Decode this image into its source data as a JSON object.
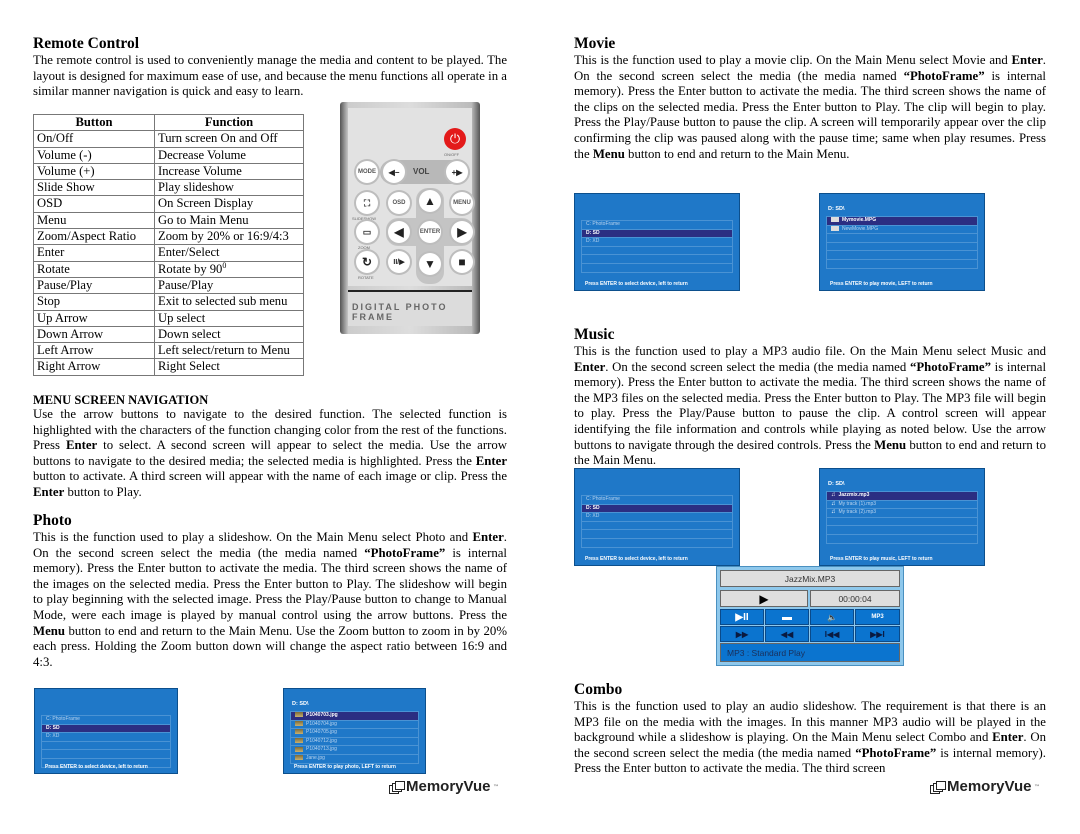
{
  "left": {
    "remote_control": {
      "title": "Remote Control",
      "intro": "The remote control is used to conveniently manage the media and content to be played. The layout is designed for maximum ease of use, and because the menu functions all operate in a similar manner navigation is quick and easy to learn.",
      "table": {
        "headers": [
          "Button",
          "Function"
        ],
        "rows": [
          [
            "On/Off",
            "Turn screen On and Off"
          ],
          [
            "Volume (-)",
            "Decrease Volume"
          ],
          [
            "Volume (+)",
            "Increase Volume"
          ],
          [
            "Slide Show",
            "Play slideshow"
          ],
          [
            "OSD",
            "On Screen Display"
          ],
          [
            "Menu",
            "Go to Main Menu"
          ],
          [
            "Zoom/Aspect Ratio",
            "Zoom by 20% or 16:9/4:3"
          ],
          [
            "Enter",
            "Enter/Select"
          ],
          [
            "Rotate",
            "Rotate by 90"
          ],
          [
            "Pause/Play",
            "Pause/Play"
          ],
          [
            "Stop",
            "Exit to selected sub menu"
          ],
          [
            "Up Arrow",
            "Up select"
          ],
          [
            "Down Arrow",
            "Down select"
          ],
          [
            "Left Arrow",
            "Left select/return to Menu"
          ],
          [
            "Right Arrow",
            "Right Select"
          ]
        ],
        "rotate_superscript": "0"
      },
      "remote_image": {
        "power_label": "ON/OFF",
        "mode": "MODE",
        "vol": "VOL",
        "vol_minus": "◀−",
        "vol_plus": "+▶",
        "slideshow_label": "SLIDESHOW",
        "osd": "OSD",
        "menu": "MENU",
        "enter": "ENTER",
        "zoom_label": "ZOOM",
        "rotate_label": "ROTATE",
        "up": "▲",
        "down": "▼",
        "left": "◀",
        "right": "▶",
        "pause_play": "II/▶",
        "stop": "■",
        "brand_strip": "DIGITAL PHOTO FRAME"
      }
    },
    "menu_nav": {
      "title": "MENU SCREEN NAVIGATION",
      "p1": "Use the arrow buttons to navigate to the desired function. The selected function is highlighted with the characters of the function changing color from the rest of the functions. Press ",
      "b1": "Enter",
      "p2": " to select. A second screen will appear to select the media. Use the arrow buttons to navigate to the desired media; the selected media is highlighted. Press the ",
      "b2": "Enter",
      "p3": " button to activate. A third screen will appear with the name of each image or clip. Press the ",
      "b3": "Enter",
      "p4": " button to Play."
    },
    "photo": {
      "title": "Photo",
      "p1": "This is the function used to play a slideshow. On the Main Menu select Photo and ",
      "b1": "Enter",
      "p2": ". On the second screen select the media (the media named ",
      "b2": "“PhotoFrame”",
      "p3": " is internal memory). Press the Enter button to activate the media.  The third screen shows the name of the images on the selected media. Press the Enter button to Play. The slideshow will begin to play beginning with the selected image. Press the Play/Pause button to change to Manual Mode, were each image is played by manual control using the arrow buttons. Press the ",
      "b3": "Menu",
      "p4": " button to end and return to the Main Menu. Use the Zoom button to zoom in by 20% each press. Holding the Zoom button down will change the aspect ratio between 16:9 and 4:3.",
      "device_screen": {
        "rows": [
          "C:  PhotoFrame",
          "D:  SD",
          "D:  XD",
          "",
          "",
          ""
        ],
        "selected": 1,
        "footer": "Press ENTER to select device, left to return"
      },
      "file_screen": {
        "header": "D: SD\\",
        "rows": [
          "P1040703.jpg",
          "P1040704.jpg",
          "P1040705.jpg",
          "P1040712.jpg",
          "P1040713.jpg",
          "Jane.jpg"
        ],
        "selected": 0,
        "footer": "Press ENTER to play photo, LEFT to return"
      }
    },
    "logo": "MemoryVue",
    "logo_mark": "™"
  },
  "right": {
    "movie": {
      "title": "Movie",
      "p1": "This is the function used to play a movie clip. On the Main Menu select Movie and ",
      "b1": "Enter",
      "p2": ". On the second screen select the media (the media named ",
      "b2": "“PhotoFrame”",
      "p3": " is internal memory). Press the Enter button to activate the media.  The third screen shows the name of the clips on the selected media. Press the Enter button to Play. The clip will begin to play. Press the Play/Pause button to pause the clip. A screen will temporarily appear over the clip confirming the clip was paused along with the pause time; same when play resumes. Press the ",
      "b3": "Menu",
      "p4": " button to end and return to the Main Menu.",
      "device_screen": {
        "rows": [
          "C:  PhotoFrame",
          "D:  SD",
          "D:  XD",
          "",
          "",
          ""
        ],
        "selected": 1,
        "footer": "Press ENTER to select device, left to return"
      },
      "file_screen": {
        "header": "D: SD\\",
        "rows": [
          "Mymovie.MPG",
          "NewMovie.MPG",
          "",
          "",
          "",
          ""
        ],
        "selected": 0,
        "footer": "Press ENTER to play movie, LEFT to return"
      }
    },
    "music": {
      "title": "Music",
      "p1": "This is the function used to play a MP3 audio file. On the Main Menu select Music and ",
      "b1": "Enter",
      "p2": ". On the second screen select the media (the media named ",
      "b2": "“PhotoFrame”",
      "p3": " is internal memory). Press the Enter button to activate the media.  The third screen shows the name of the MP3 files on the selected media. Press the Enter button to Play. The MP3 file will begin to play. Press the Play/Pause button to pause the clip. A control screen will appear identifying the file information and controls while playing as noted below. Use the arrow buttons to navigate through the desired controls. Press the ",
      "b3": "Menu",
      "p4": " button to end and return to the Main Menu.",
      "device_screen": {
        "rows": [
          "C:  PhotoFrame",
          "D:  SD",
          "D:  XD",
          "",
          "",
          ""
        ],
        "selected": 1,
        "footer": "Press ENTER to select device, left to return"
      },
      "file_screen": {
        "header": "D: SD\\",
        "rows": [
          "Jazzmix.mp3",
          "My track (1).mp3",
          "My track (2).mp3",
          "",
          "",
          ""
        ],
        "selected": 0,
        "footer": "Press ENTER to play music, LEFT to return"
      },
      "player": {
        "filename": "JazzMix.MP3",
        "state_icon": "▶",
        "time": "00:00:04",
        "buttons_row1": [
          "▶II",
          "▬",
          "🔈",
          "MP3"
        ],
        "buttons_row2": [
          "▶▶",
          "◀◀",
          "I◀◀",
          "▶▶I"
        ],
        "status": "MP3 : Standard Play"
      }
    },
    "combo": {
      "title": "Combo",
      "p1": "This is the function used to play an audio slideshow. The requirement is that there is an MP3 file on the media with the images. In this manner MP3 audio will be played in the background while a slideshow is playing. On the Main Menu select Combo and ",
      "b1": "Enter",
      "p2": ". On the second screen select the media (the media named ",
      "b2": "“PhotoFrame”",
      "p3": " is internal memory). Press the Enter button to activate the media.  The third screen"
    },
    "logo": "MemoryVue",
    "logo_mark": "™"
  }
}
